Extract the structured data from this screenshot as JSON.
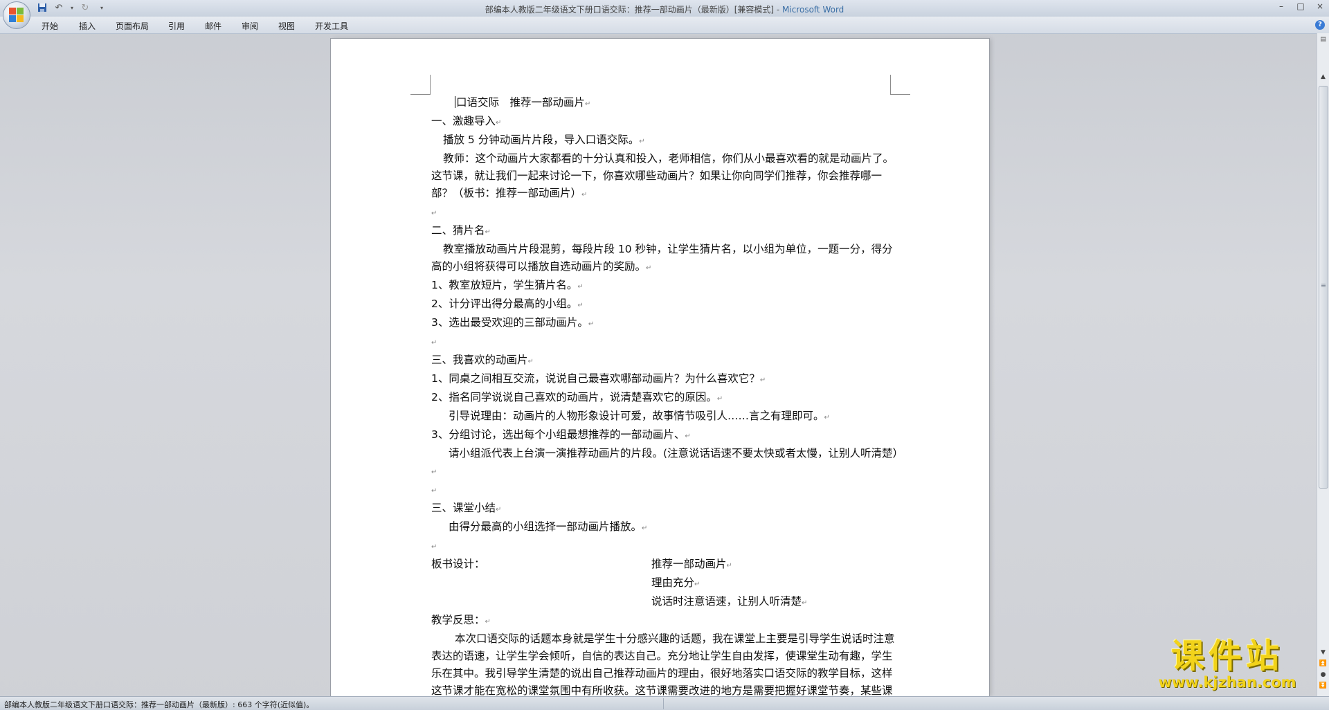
{
  "window": {
    "doc_title": "部编本人教版二年级语文下册口语交际：推荐一部动画片（最新版）[兼容模式]",
    "separator": " - ",
    "app_name": "Microsoft Word",
    "minimize": "–",
    "maximize": "□",
    "close": "×"
  },
  "qat": {
    "save_icon": "floppy-disk",
    "undo_icon": "undo-arrow",
    "redo_icon": "redo-arrow",
    "customize_icon": "chevron-down"
  },
  "ribbon": {
    "tabs": [
      "开始",
      "插入",
      "页面布局",
      "引用",
      "邮件",
      "审阅",
      "视图",
      "开发工具"
    ],
    "help": "?"
  },
  "document": {
    "title": "口语交际　推荐一部动画片",
    "s1_head": "一、激趣导入",
    "s1_p1": "播放 5 分钟动画片片段，导入口语交际。",
    "s1_p2": "教师：这个动画片大家都看的十分认真和投入，老师相信，你们从小最喜欢看的就是动画片了。这节课，就让我们一起来讨论一下，你喜欢哪些动画片？如果让你向同学们推荐，你会推荐哪一部？（板书：推荐一部动画片）",
    "s2_head": "二、猜片名",
    "s2_p1": "教室播放动画片片段混剪，每段片段 10 秒钟，让学生猜片名，以小组为单位，一题一分，得分高的小组将获得可以播放自选动画片的奖励。",
    "s2_i1": "1、教室放短片，学生猜片名。",
    "s2_i2": "2、计分评出得分最高的小组。",
    "s2_i3": "3、选出最受欢迎的三部动画片。",
    "s3_head": "三、我喜欢的动画片",
    "s3_i1": "1、同桌之间相互交流，说说自己最喜欢哪部动画片？为什么喜欢它？",
    "s3_i2": "2、指名同学说说自己喜欢的动画片，说清楚喜欢它的原因。",
    "s3_p1": "引导说理由：动画片的人物形象设计可爱，故事情节吸引人……言之有理即可。",
    "s3_i3": "3、分组讨论，选出每个小组最想推荐的一部动画片、",
    "s3_p2": "请小组派代表上台演一演推荐动画片的片段。(注意说话语速不要太快或者太慢，让别人听清楚）",
    "s4_head": "三、课堂小结",
    "s4_p1": "由得分最高的小组选择一部动画片播放。",
    "board_label": "板书设计：",
    "board_l1": "推荐一部动画片",
    "board_l2": "理由充分",
    "board_l3": "说话时注意语速，让别人听清楚",
    "reflect_head": "教学反思：",
    "reflect_p": "本次口语交际的话题本身就是学生十分感兴趣的话题，我在课堂上主要是引导学生说话时注意表达的语速，让学生学会倾听，自信的表达自己。充分地让学生自由发挥，使课堂生动有趣，学生乐在其中。我引导学生清楚的说出自己推荐动画片的理由，很好地落实口语交际的教学目标，这样这节课才能在宽松的课堂氛围中有所收获。这节课需要改进的地方是需要把握好课堂节奏，某些课堂环节要控制好时间，不能太长，要在一个环节之后，加上适当的总结就更好了。",
    "para_mark": "↵"
  },
  "statusbar": {
    "text": "部编本人教版二年级语文下册口语交际：推荐一部动画片（最新版）: 663 个字符(近似值)。"
  },
  "watermark": {
    "title": "课件站",
    "url": "www.kjzhan.com"
  }
}
